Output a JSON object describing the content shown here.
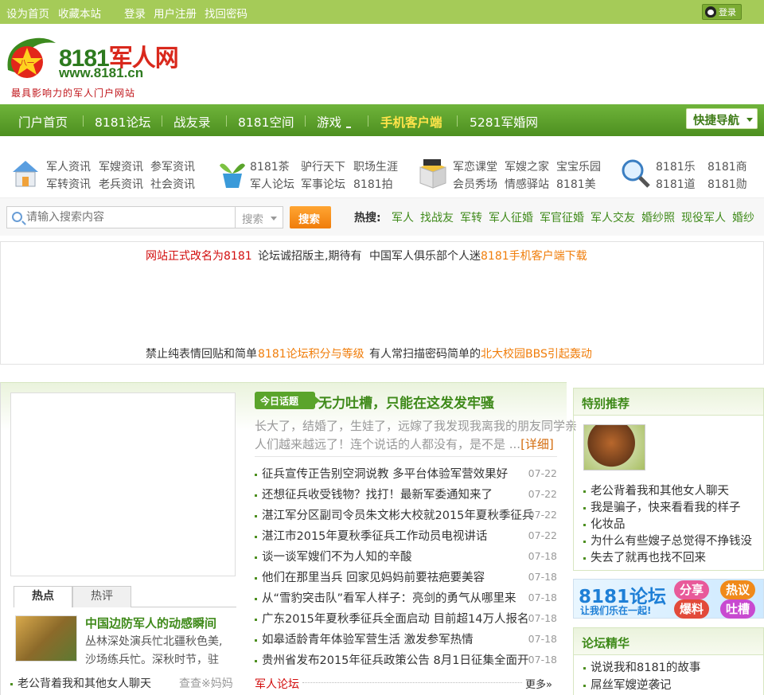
{
  "topbar": {
    "set_home": "设为首页",
    "bookmark": "收藏本站",
    "login": "登录",
    "register": "用户注册",
    "recover": "找回密码",
    "qq_login": "登录"
  },
  "logo": {
    "brand_digits": "8181",
    "brand_name": "军人网",
    "url": "www.8181.cn",
    "slogan": "最具影响力的军人门户网站",
    "star_text": "八一"
  },
  "nav": {
    "items": [
      "门户首页",
      "8181论坛",
      "战友录",
      "8181空间",
      "游戏",
      "手机客户端",
      "5281军婚网"
    ],
    "quick_nav": "快捷导航"
  },
  "channels": {
    "group1": [
      "军人资讯",
      "军嫂资讯",
      "参军资讯",
      "军转资讯",
      "老兵资讯",
      "社会资讯"
    ],
    "group2": [
      "8181茶",
      "驴行天下",
      "职场生涯",
      "军人论坛",
      "军事论坛",
      "8181拍"
    ],
    "group3": [
      "军恋课堂",
      "军嫂之家",
      "宝宝乐园",
      "会员秀场",
      "情感驿站",
      "8181美"
    ],
    "group4": [
      "8181乐",
      "8181商",
      "8181道",
      "8181勋"
    ]
  },
  "search": {
    "placeholder": "请输入搜索内容",
    "select": "搜索",
    "button": "搜索",
    "hot_label": "热搜:",
    "hot": [
      "军人",
      "找战友",
      "军转",
      "军人征婚",
      "军官征婚",
      "军人交友",
      "婚纱照",
      "现役军人",
      "婚纱"
    ]
  },
  "notice": {
    "l1a": "网站正式改名为8181",
    "l1b": "论坛诚招版主,期待有",
    "l1c": "中国军人俱乐部个人迷",
    "l1d": "8181手机客户端下载",
    "l2a": "禁止纯表情回贴和简单",
    "l2b": "8181论坛积分与等级",
    "l2c": "有人常扫描密码简单的",
    "l2d": "北大校园BBS引起轰动"
  },
  "left": {
    "tab_hot": "热点",
    "tab_review": "热评",
    "hot_title": "中国边防军人的动感瞬间",
    "hot_desc1": "丛林深处演兵忙北疆秋色美,",
    "hot_desc2": "沙场练兵忙。深秋时节，驻",
    "bottom_item": "老公背着我和其他女人聊天",
    "bottom_right": "查查※妈妈"
  },
  "middle": {
    "badge": "今日话题",
    "title": "无力吐槽，只能在这发发牢骚",
    "summary1": "长大了，结婚了，生娃了，远嫁了我发现我离我的朋友同学亲",
    "summary2": "人们越来越远了！连个说话的人都没有，是不是 ...",
    "detail": "[详细]",
    "news": [
      {
        "title": "征兵宣传正告别空洞说教 多平台体验军营效果好",
        "date": "07-22"
      },
      {
        "title": "还想征兵收受钱物？找打！最新军委通知来了",
        "date": "07-22"
      },
      {
        "title": "湛江军分区副司令员朱文彬大校就2015年夏秋季征兵",
        "date": "07-22"
      },
      {
        "title": "湛江市2015年夏秋季征兵工作动员电视讲话",
        "date": "07-22"
      },
      {
        "title": "谈一谈军嫂们不为人知的辛酸",
        "date": "07-18"
      },
      {
        "title": "他们在那里当兵 回家见妈妈前要祛疤要美容",
        "date": "07-18"
      },
      {
        "title": "从“雪豹突击队”看军人样子：亮剑的勇气从哪里来",
        "date": "07-18"
      },
      {
        "title": "广东2015年夏秋季征兵全面启动 目前超14万人报名",
        "date": "07-18"
      },
      {
        "title": "如皋适龄青年体验军营生活 激发参军热情",
        "date": "07-18"
      },
      {
        "title": "贵州省发布2015年征兵政策公告 8月1日征集全面开",
        "date": "07-18"
      }
    ],
    "forum_label": "军人论坛",
    "more": "更多»"
  },
  "right": {
    "special_head": "特别推荐",
    "special_items": [
      "老公背着我和其他女人聊天",
      "我是骗子，快来看看我的样子",
      "化妆品",
      "为什么有些嫂子总觉得不挣钱没",
      "失去了就再也找不回来"
    ],
    "banner_title": "8181论坛",
    "banner_sub": "让我们乐在一起!",
    "bubbles": [
      "分享",
      "热议",
      "爆料",
      "吐槽"
    ],
    "best_head": "论坛精华",
    "best_items": [
      "说说我和8181的故事",
      "屌丝军嫂逆袭记"
    ]
  },
  "colors": {
    "brand_green": "#4d8f20",
    "topbar": "#a5cb58",
    "accent_orange": "#f07d0a",
    "alert_red": "#d20d0d"
  }
}
